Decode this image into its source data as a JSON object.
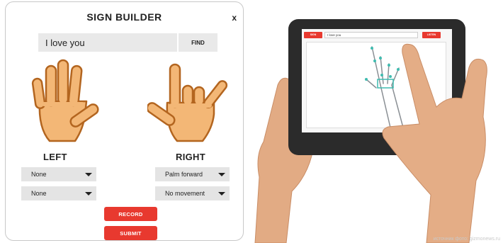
{
  "builder": {
    "title": "SIGN BUILDER",
    "close": "x",
    "search": {
      "value": "I love you"
    },
    "find_label": "FIND",
    "left": {
      "label": "LEFT",
      "orientation": "None",
      "movement": "None"
    },
    "right": {
      "label": "RIGHT",
      "orientation": "Palm forward",
      "movement": "No movement"
    },
    "record_label": "RECORD",
    "submit_label": "SUBMIT"
  },
  "tablet": {
    "left_button": "SIGN",
    "input_value": "I love you",
    "right_button": "LISTEN"
  },
  "watermark": "источник фото: gizmonews.ru",
  "colors": {
    "accent_red": "#e8392f",
    "skin": "#f3b776",
    "skin_outline": "#b3651f",
    "field_gray": "#e9e9e9",
    "tablet_frame": "#2b2b2b"
  }
}
